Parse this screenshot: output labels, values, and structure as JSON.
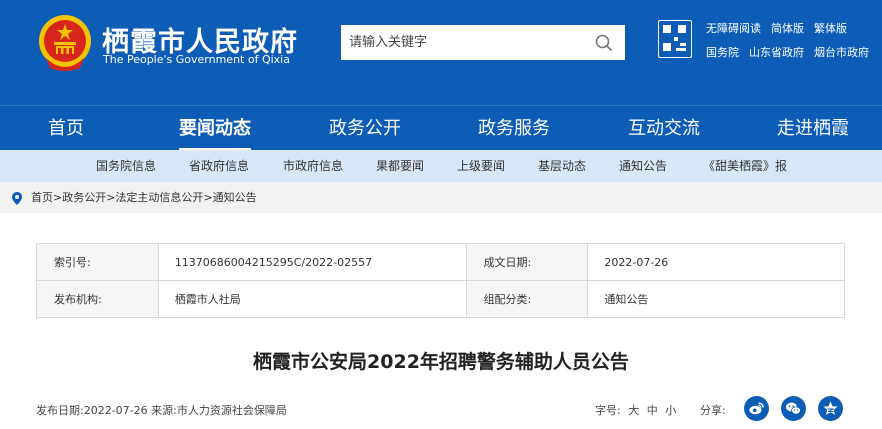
{
  "header": {
    "title": "栖霞市人民政府",
    "subtitle": "The People's Government of Qixia",
    "search_placeholder": "请输入关键字",
    "links_row1": [
      "无障碍阅读",
      "简体版",
      "繁体版"
    ],
    "links_row2": [
      "国务院",
      "山东省政府",
      "烟台市政府"
    ]
  },
  "nav": {
    "items": [
      "首页",
      "要闻动态",
      "政务公开",
      "政务服务",
      "互动交流",
      "走进栖霞"
    ],
    "active": "要闻动态"
  },
  "subnav": {
    "items": [
      "国务院信息",
      "省政府信息",
      "市政府信息",
      "果都要闻",
      "上级要闻",
      "基层动态",
      "通知公告",
      "《甜美栖霞》报"
    ]
  },
  "breadcrumb": [
    "首页",
    "政务公开",
    "法定主动信息公开",
    "通知公告"
  ],
  "meta": {
    "index_label": "索引号:",
    "index_value": "11370686004215295C/2022-02557",
    "date_label": "成文日期:",
    "date_value": "2022-07-26",
    "org_label": "发布机构:",
    "org_value": "栖霞市人社局",
    "category_label": "组配分类:",
    "category_value": "通知公告"
  },
  "article": {
    "title": "栖霞市公安局2022年招聘警务辅助人员公告",
    "info": "发布日期:2022-07-26 来源:市人力资源社会保障局",
    "fontsize_label": "字号:",
    "sizes": [
      "大",
      "中",
      "小"
    ],
    "share_label": "分享:"
  },
  "colors": {
    "brand_blue": "#0d5cb6",
    "subnav_bg": "#d9e8f9",
    "emblem_red": "#d9261c",
    "emblem_gold": "#f5c400"
  },
  "icons": [
    "national-emblem-icon",
    "search-icon",
    "qr-code-icon",
    "location-pin-icon",
    "weibo-icon",
    "wechat-icon",
    "qzone-icon"
  ]
}
